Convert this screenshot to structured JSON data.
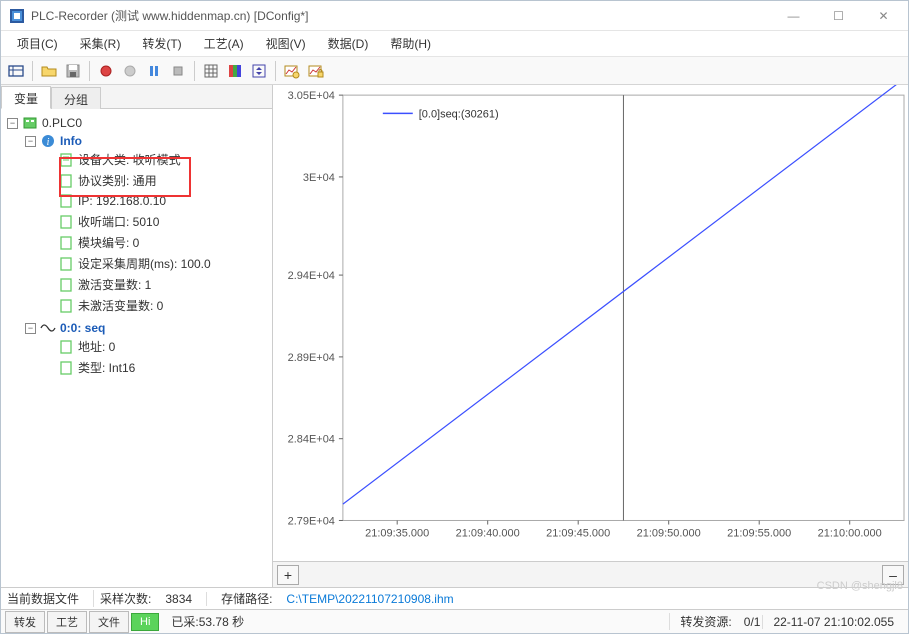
{
  "window": {
    "title": "PLC-Recorder (测试 www.hiddenmap.cn) [DConfig*]"
  },
  "menu": [
    "项目(C)",
    "采集(R)",
    "转发(T)",
    "工艺(A)",
    "视图(V)",
    "数据(D)",
    "帮助(H)"
  ],
  "tabs": {
    "active": "变量",
    "inactive": "分组"
  },
  "tree": {
    "root": "0.PLC0",
    "info": "Info",
    "info_items": [
      "设备大类: 收听模式",
      "协议类别: 通用",
      "IP: 192.168.0.10",
      "收听端口: 5010",
      "模块编号: 0",
      "设定采集周期(ms): 100.0",
      "激活变量数: 1",
      "未激活变量数: 0"
    ],
    "seq": "0:0: seq",
    "seq_items": [
      "地址: 0",
      "类型: Int16"
    ]
  },
  "chart_data": {
    "type": "line",
    "legend": "[0.0]seq:(30261)",
    "ylabel": "",
    "ytick_labels": [
      "2.79E+04",
      "2.84E+04",
      "2.89E+04",
      "2.94E+04",
      "3E+04",
      "3.05E+04"
    ],
    "ytick_values": [
      27900,
      28400,
      28900,
      29400,
      30000,
      30500
    ],
    "ylim": [
      27900,
      30500
    ],
    "xlabel": "",
    "xtick_labels": [
      "21:09:35.000",
      "21:09:40.000",
      "21:09:45.000",
      "21:09:50.000",
      "21:09:55.000",
      "21:10:00.000"
    ],
    "xtick_values": [
      0,
      5,
      10,
      15,
      20,
      25
    ],
    "xlim": [
      -3,
      28
    ],
    "series": [
      {
        "name": "[0.0]seq",
        "points": [
          [
            -3,
            28000
          ],
          [
            28,
            30600
          ]
        ]
      }
    ],
    "cursor_x": 12.5
  },
  "plus_btn": "+",
  "minus_btn": "–",
  "status1": {
    "label_file": "当前数据文件",
    "label_samples": "采样次数:",
    "samples": "3834",
    "label_path": "存储路径:",
    "path": "C:\\TEMP\\20221107210908.ihm"
  },
  "status2": {
    "btns": [
      "转发",
      "工艺",
      "文件"
    ],
    "hi": "Hi",
    "elapsed": "已采:53.78 秒",
    "fwd_res": "转发资源:",
    "fwd_val": "0/1",
    "time": "22-11-07 21:10:02.055"
  },
  "watermark": "CSDN @shengjl8"
}
